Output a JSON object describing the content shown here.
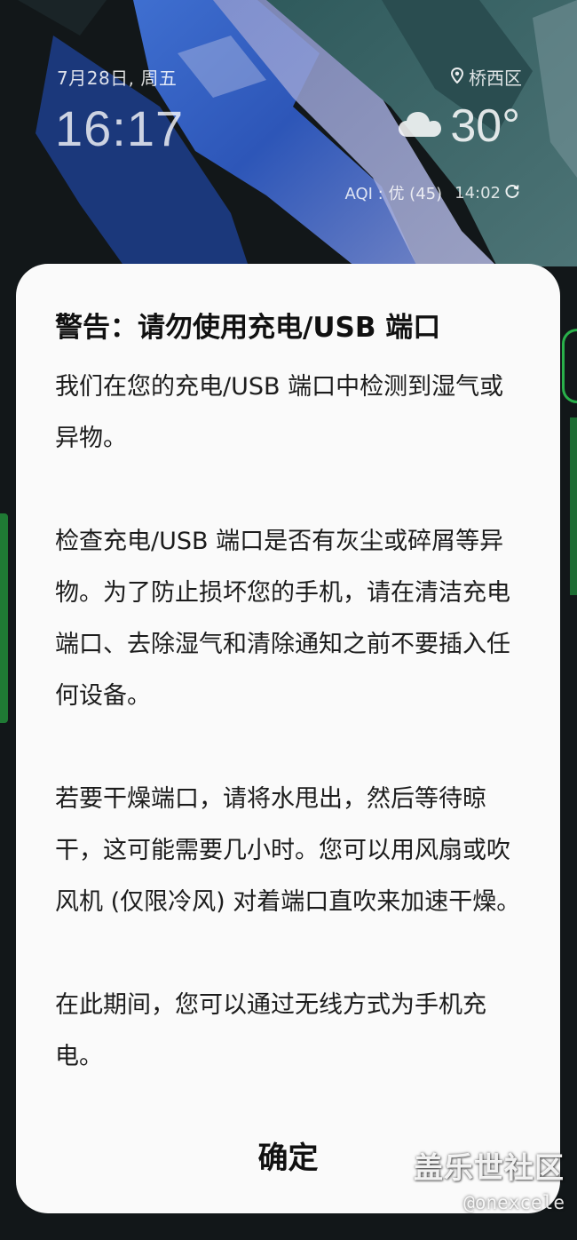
{
  "lockscreen": {
    "date": "7月28日, 周五",
    "time": "16:17",
    "location": "桥西区",
    "temperature": "30°",
    "aqi": "AQI : 优 (45)",
    "updated_time": "14:02",
    "weather_icon": "cloud-icon",
    "location_icon": "location-pin-icon",
    "refresh_icon": "refresh-icon"
  },
  "dialog": {
    "title": "警告：请勿使用充电/USB 端口",
    "paragraphs": [
      "我们在您的充电/USB 端口中检测到湿气或异物。",
      "检查充电/USB 端口是否有灰尘或碎屑等异物。为了防止损坏您的手机，请在清洁充电端口、去除湿气和清除通知之前不要插入任何设备。",
      "若要干燥端口，请将水甩出，然后等待晾干，这可能需要几小时。您可以用风扇或吹风机 (仅限冷风) 对着端口直吹来加速干燥。",
      "在此期间，您可以通过无线方式为手机充电。"
    ],
    "ok_label": "确定"
  },
  "watermark": {
    "brand": "盖乐世社区",
    "handle": "@onexcele"
  },
  "colors": {
    "dialog_background": "#fafafa",
    "text": "#111111",
    "edge_accent": "#29b04a"
  }
}
